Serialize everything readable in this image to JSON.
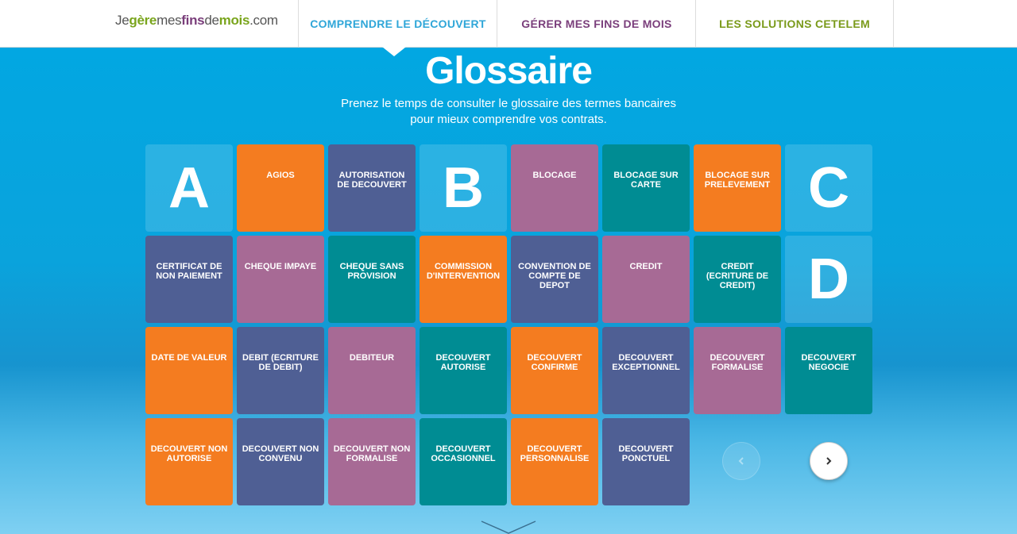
{
  "header": {
    "logo": [
      "Je",
      "gère",
      "mes",
      "fins",
      "de",
      "mois",
      ".com"
    ],
    "logo_colors": [
      "#555555",
      "#7aa51d",
      "#555555",
      "#7a3e7b",
      "#555555",
      "#7aa51d",
      "#555555"
    ],
    "nav": [
      "COMPRENDRE LE DÉCOUVERT",
      "GÉRER MES FINS DE MOIS",
      "LES SOLUTIONS CETELEM"
    ]
  },
  "page": {
    "title": "Glossaire",
    "subtitle_line1": "Prenez le temps de consulter le glossaire des termes bancaires",
    "subtitle_line2": "pour mieux comprendre vos contrats."
  },
  "letters": [
    "A",
    "B",
    "C",
    "D"
  ],
  "terms": [
    {
      "label": "AGIOS",
      "color": "orange"
    },
    {
      "label": "AUTORISATION DE DECOUVERT",
      "color": "slate"
    },
    {
      "label": "BLOCAGE",
      "color": "mauve"
    },
    {
      "label": "BLOCAGE SUR CARTE",
      "color": "teal"
    },
    {
      "label": "BLOCAGE SUR PRELEVEMENT",
      "color": "orange"
    },
    {
      "label": "CERTIFICAT DE NON PAIEMENT",
      "color": "slate"
    },
    {
      "label": "CHEQUE IMPAYE",
      "color": "mauve"
    },
    {
      "label": "CHEQUE SANS PROVISION",
      "color": "teal"
    },
    {
      "label": "COMMISSION D'INTERVENTION",
      "color": "orange"
    },
    {
      "label": "CONVENTION DE COMPTE DE DEPOT",
      "color": "slate"
    },
    {
      "label": "CREDIT",
      "color": "mauve"
    },
    {
      "label": "CREDIT (ECRITURE DE CREDIT)",
      "color": "teal"
    },
    {
      "label": "DATE DE VALEUR",
      "color": "orange"
    },
    {
      "label": "DEBIT (ECRITURE DE DEBIT)",
      "color": "slate"
    },
    {
      "label": "DEBITEUR",
      "color": "mauve"
    },
    {
      "label": "DECOUVERT AUTORISE",
      "color": "teal"
    },
    {
      "label": "DECOUVERT CONFIRME",
      "color": "orange"
    },
    {
      "label": "DECOUVERT EXCEPTIONNEL",
      "color": "slate"
    },
    {
      "label": "DECOUVERT FORMALISE",
      "color": "mauve"
    },
    {
      "label": "DECOUVERT NEGOCIE",
      "color": "teal"
    },
    {
      "label": "DECOUVERT NON AUTORISE",
      "color": "orange"
    },
    {
      "label": "DECOUVERT NON CONVENU",
      "color": "slate"
    },
    {
      "label": "DECOUVERT NON FORMALISE",
      "color": "mauve"
    },
    {
      "label": "DECOUVERT OCCASIONNEL",
      "color": "teal"
    },
    {
      "label": "DECOUVERT PERSONNALISE",
      "color": "orange"
    },
    {
      "label": "DECOUVERT PONCTUEL",
      "color": "slate"
    }
  ],
  "pagination": {
    "prev_icon": "chevron-left-icon",
    "next_icon": "chevron-right-icon",
    "prev_disabled": true
  }
}
